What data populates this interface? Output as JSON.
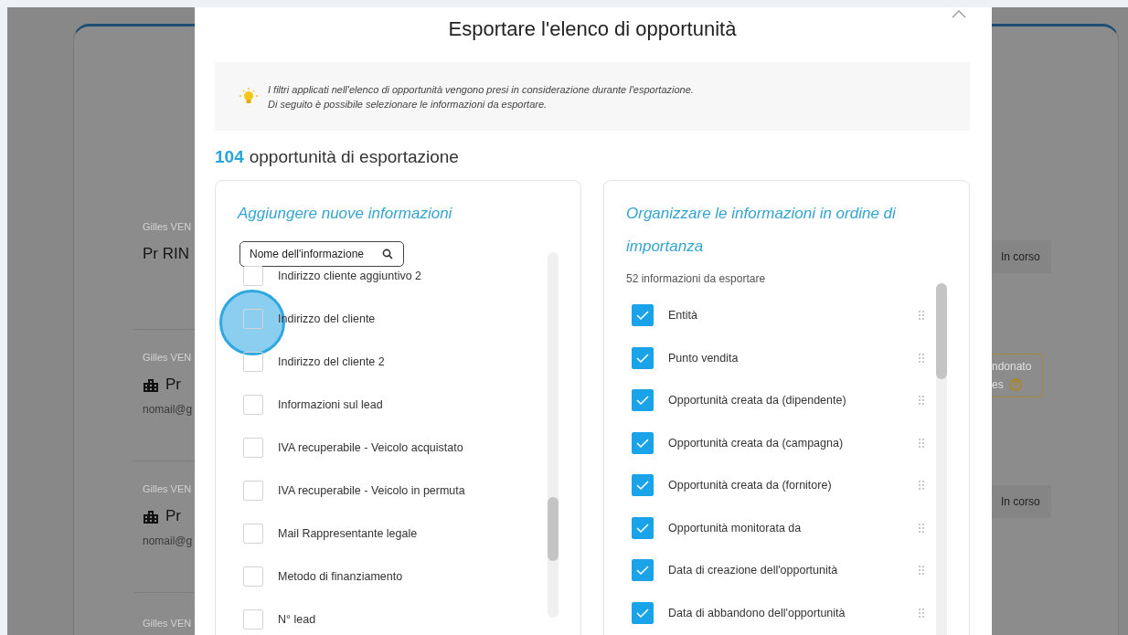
{
  "background": {
    "left_rows": [
      {
        "author": "Gilles VEN",
        "title": "Pr RIN",
        "building": false
      },
      {
        "author": "Gilles VEN",
        "title": "Pr",
        "building": true,
        "email": "nomail@g"
      },
      {
        "author": "Gilles VEN",
        "title": "Pr",
        "building": true,
        "email": "nomail@g"
      },
      {
        "author": "Gilles VEN"
      }
    ],
    "right_rows": [
      {
        "kind": "badge",
        "text": "In corso"
      },
      {
        "kind": "warning",
        "lines": [
          "ndonato",
          "es"
        ]
      },
      {
        "kind": "badge",
        "text": "In corso"
      }
    ]
  },
  "modal": {
    "title": "Esportare l'elenco di opportunità",
    "info": [
      "I filtri applicati nell'elenco di opportunità vengono presi in considerazione durante l'esportazione.",
      "Di seguito è possibile selezionare le informazioni da esportare."
    ],
    "count": "104",
    "count_label": "opportunità di esportazione",
    "available": {
      "heading": "Aggiungere nuove informazioni",
      "search": {
        "placeholder": "Nome dell'informazione"
      },
      "items": [
        {
          "label": "Indirizzo cliente aggiuntivo 2",
          "checked": false
        },
        {
          "label": "Indirizzo del cliente",
          "checked": false
        },
        {
          "label": "Indirizzo del cliente 2",
          "checked": false
        },
        {
          "label": "Informazioni sul lead",
          "checked": false
        },
        {
          "label": "IVA recuperabile - Veicolo acquistato",
          "checked": false
        },
        {
          "label": "IVA recuperabile - Veicolo in permuta",
          "checked": false
        },
        {
          "label": "Mail Rappresentante legale",
          "checked": false
        },
        {
          "label": "Metodo di finanziamento",
          "checked": false
        },
        {
          "label": "N° lead",
          "checked": false
        }
      ]
    },
    "selected": {
      "heading": "Organizzare le informazioni in ordine di importanza",
      "subtitle": "52 informazioni da esportare",
      "items": [
        {
          "label": "Entità",
          "checked": true
        },
        {
          "label": "Punto vendita",
          "checked": true
        },
        {
          "label": "Opportunità creata da (dipendente)",
          "checked": true
        },
        {
          "label": "Opportunità creata da (campagna)",
          "checked": true
        },
        {
          "label": "Opportunità creata da (fornitore)",
          "checked": true
        },
        {
          "label": "Opportunità monitorata da",
          "checked": true
        },
        {
          "label": "Data di creazione dell'opportunità",
          "checked": true
        },
        {
          "label": "Data di abbandono dell'opportunità",
          "checked": true
        }
      ]
    }
  }
}
